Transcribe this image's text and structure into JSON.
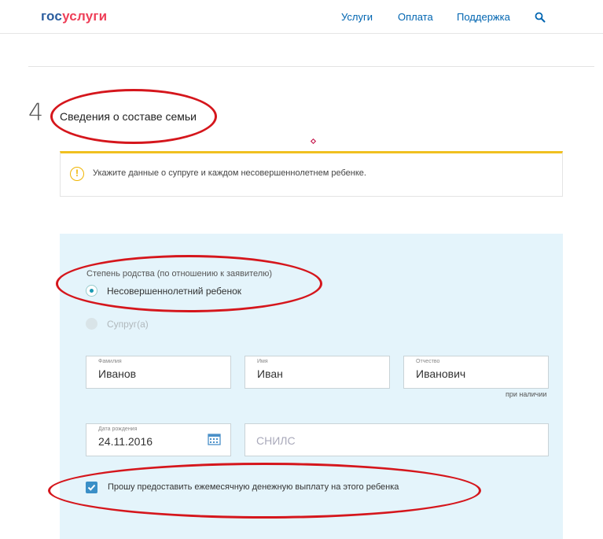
{
  "header": {
    "logo_gos": "гос",
    "logo_uslugi": "услуги",
    "nav": [
      "Услуги",
      "Оплата",
      "Поддержка"
    ],
    "search_icon": "search-icon"
  },
  "step": {
    "number": "4",
    "title": "Сведения о составе семьи"
  },
  "alert": {
    "icon": "warning-icon",
    "text": "Укажите данные о супруге и каждом несовершеннолетнем ребенке."
  },
  "form": {
    "relation_label": "Степень родства (по отношению к заявителю)",
    "relation_options": [
      "Несовершеннолетний ребенок",
      "Супруг(а)"
    ],
    "relation_selected": "Несовершеннолетний ребенок",
    "surname": {
      "label": "Фамилия",
      "value": "Иванов"
    },
    "name": {
      "label": "Имя",
      "value": "Иван"
    },
    "patronymic": {
      "label": "Отчество",
      "value": "Иванович",
      "hint": "при наличии"
    },
    "birthdate": {
      "label": "Дата рождения",
      "value": "24.11.2016"
    },
    "snils": {
      "placeholder": "СНИЛС"
    },
    "checkbox_label": "Прошу предоставить ежемесячную денежную выплату на этого ребенка",
    "checkbox_checked": true
  },
  "colors": {
    "logo_blue": "#2b5d9e",
    "logo_red": "#ee3f58",
    "link": "#0065b1",
    "panel_bg": "#e4f4fb",
    "alert_accent": "#f0c020",
    "annotation_red": "#d5161c"
  }
}
